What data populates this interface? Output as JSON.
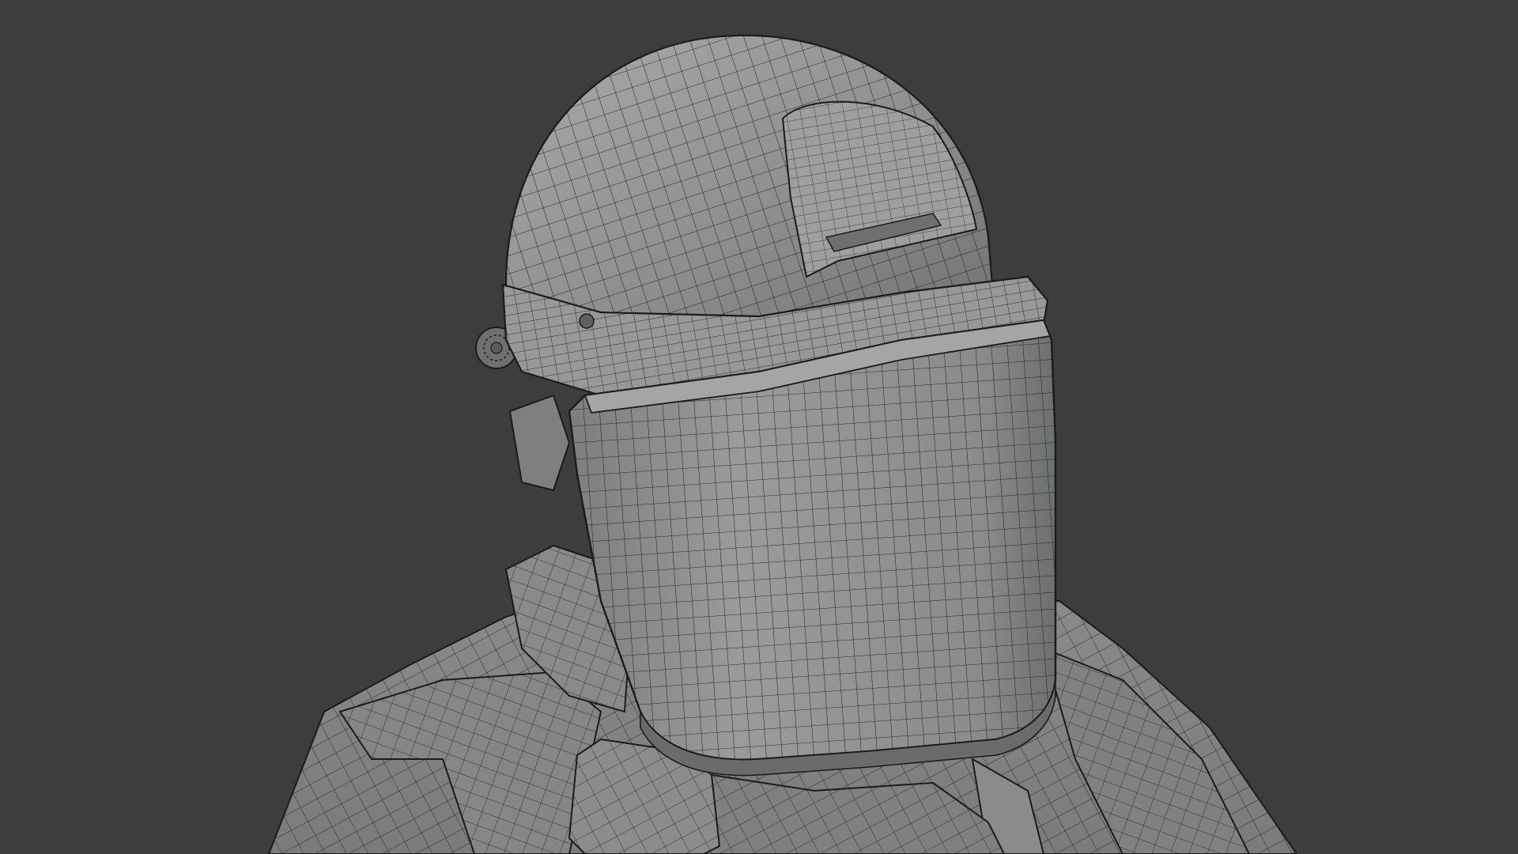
{
  "viewport": {
    "background": "#3d3d3d",
    "shading": "solid-grey-wireframe-overlay"
  },
  "model": {
    "subject": "riot-helmet-with-face-shield",
    "mesh_color": "#8f9090",
    "mesh_highlight": "#a9aaaa",
    "mesh_shadow": "#6a6b6b",
    "wire_color": "#1b1b1b"
  }
}
